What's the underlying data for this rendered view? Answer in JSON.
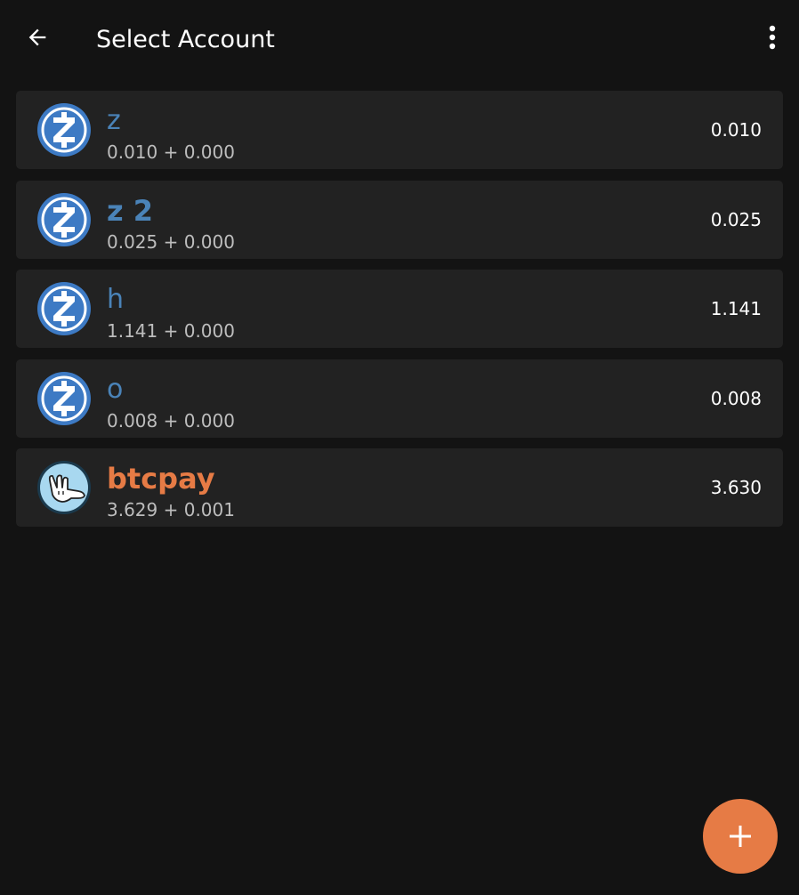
{
  "header": {
    "title": "Select Account",
    "back_icon": "arrow-left-icon",
    "menu_icon": "more-vert-icon"
  },
  "accounts": [
    {
      "name": "z",
      "balance_detail": "0.010 + 0.000",
      "total": "0.010",
      "icon": "zcash-icon",
      "name_color": "#4a83b8"
    },
    {
      "name": "z 2",
      "balance_detail": "0.025 + 0.000",
      "total": "0.025",
      "icon": "zcash-icon",
      "name_color": "#4a83b8"
    },
    {
      "name": "h",
      "balance_detail": "1.141 + 0.000",
      "total": "1.141",
      "icon": "zcash-icon",
      "name_color": "#4a83b8"
    },
    {
      "name": "o",
      "balance_detail": "0.008 + 0.000",
      "total": "0.008",
      "icon": "zcash-icon",
      "name_color": "#4a83b8"
    },
    {
      "name": "btcpay",
      "balance_detail": "3.629 + 0.001",
      "total": "3.630",
      "icon": "shaka-hand-icon",
      "name_color": "#e67b45"
    }
  ],
  "fab": {
    "icon": "plus-icon"
  },
  "colors": {
    "background": "#131313",
    "card": "#222222",
    "accent": "#e67b45",
    "zcash_blue": "#3d7ac4"
  }
}
